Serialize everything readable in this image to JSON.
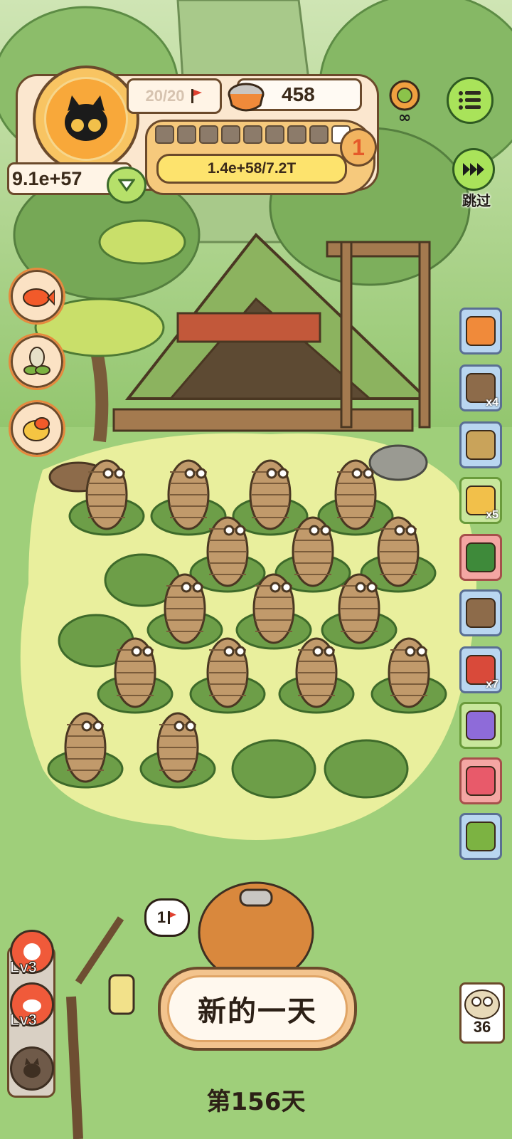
{
  "hud": {
    "flag_count": "20/20",
    "coins": "458",
    "level": "1",
    "xp": "1.4e+58/7.2T",
    "gold": "9.1e+57",
    "progress_pips_total": 9,
    "progress_pips_filled": 1
  },
  "skip": {
    "label": "跳过"
  },
  "speech_bubble": {
    "text": "1"
  },
  "bottom": {
    "new_day_label": "新的一天",
    "day_label": "第156天"
  },
  "skills": [
    {
      "level": "Lv3"
    },
    {
      "level": "Lv3"
    }
  ],
  "items": [
    {
      "icon": "lion-costume-icon",
      "count": ""
    },
    {
      "icon": "shop-building-icon",
      "count": "x4"
    },
    {
      "icon": "straw-hut-icon",
      "count": ""
    },
    {
      "icon": "seed-packet-icon",
      "count": "x5"
    },
    {
      "icon": "herb-ball-icon",
      "count": ""
    },
    {
      "icon": "wooden-chair-icon",
      "count": ""
    },
    {
      "icon": "meat-steak-icon",
      "count": "x7"
    },
    {
      "icon": "credit-card-icon",
      "count": ""
    },
    {
      "icon": "snack-bowl-icon",
      "count": ""
    },
    {
      "icon": "cabbage-icon",
      "count": ""
    }
  ],
  "buddy": {
    "count": "36"
  },
  "colors": {
    "grass": "#9fcf7a",
    "meadow": "#e9ef9d",
    "accent_green": "#a9e35a",
    "outline_brown": "#6b4a2b"
  }
}
